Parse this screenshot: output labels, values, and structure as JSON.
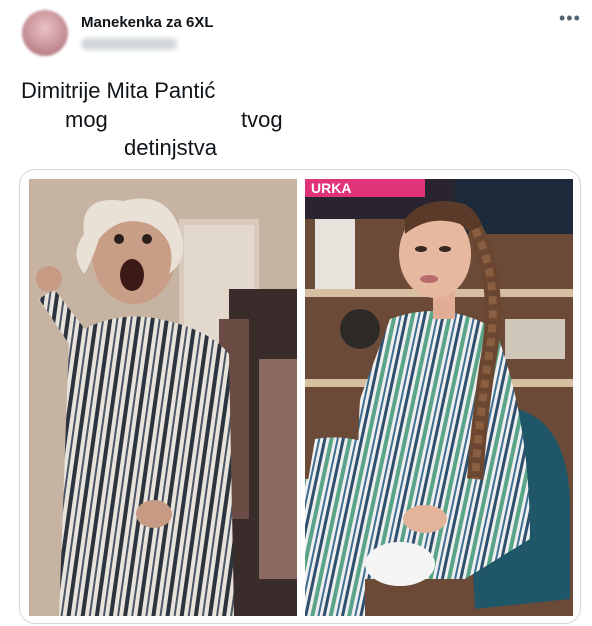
{
  "post": {
    "display_name": "Manekenka za 6XL",
    "more_icon": "more-horizontal-icon",
    "text_lines": [
      "Dimitrije Mita Pantić",
      "mog",
      "tvog",
      "detinjstva"
    ]
  },
  "media": {
    "right_photo_caption": "URKA"
  },
  "colors": {
    "text": "#0f1419",
    "secondary": "#536471",
    "border": "#cfd9de"
  }
}
